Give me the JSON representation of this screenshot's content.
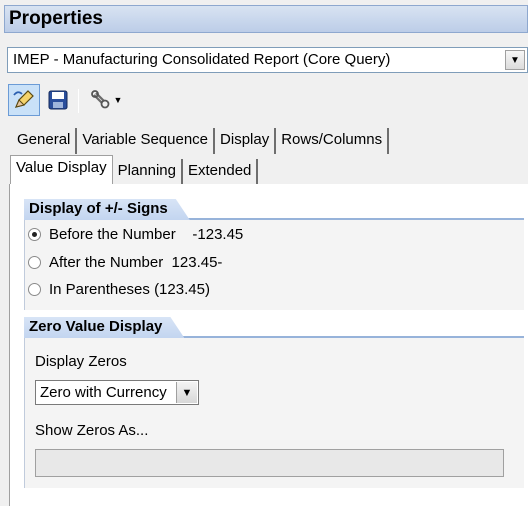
{
  "panel_title": "Properties",
  "query_selector": {
    "value": "IMEP - Manufacturing Consolidated Report (Core Query)"
  },
  "tabs_row1": [
    "General",
    "Variable Sequence",
    "Display",
    "Rows/Columns"
  ],
  "tabs_row2": [
    "Value Display",
    "Planning",
    "Extended"
  ],
  "selected_tab": "Value Display",
  "sign_group": {
    "title": "Display of +/- Signs",
    "options": [
      {
        "label": "Before the Number    -123.45",
        "checked": true
      },
      {
        "label": "After the Number  123.45-",
        "checked": false
      },
      {
        "label": "In Parentheses (123.45)",
        "checked": false
      }
    ]
  },
  "zero_group": {
    "title": "Zero Value Display",
    "display_zeros_label": "Display Zeros",
    "display_zeros_value": "Zero with Currency",
    "show_zeros_label": "Show Zeros As...",
    "show_zeros_value": ""
  }
}
